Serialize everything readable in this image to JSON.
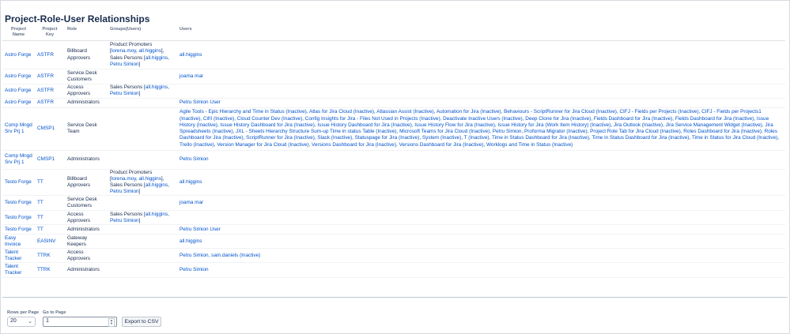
{
  "page": {
    "title": "Project-Role-User Relationships"
  },
  "table": {
    "headers": {
      "project_name": "Project\nName",
      "project_key": "Project\nKey",
      "role": "Role",
      "groups": "Groups(Users)",
      "users": "Users"
    },
    "rows": [
      {
        "name": "Astro Forge",
        "key": "ASTFR",
        "role": "Billboard Approvers",
        "groups": [
          {
            "text": "Product Promoters "
          },
          {
            "text": "[",
            "plain": true
          },
          {
            "text": "lorena.moy",
            "link": true
          },
          {
            "text": ", ",
            "plain": true
          },
          {
            "text": "all.higgins",
            "link": true
          },
          {
            "text": "],",
            "plain": true
          },
          {
            "text": " Sales Persons ",
            "plain": true
          },
          {
            "text": "[",
            "plain": true
          },
          {
            "text": "all.higgins",
            "link": true
          },
          {
            "text": ", ",
            "plain": true
          },
          {
            "text": "Petru Simion",
            "link": true
          },
          {
            "text": "]",
            "plain": true
          }
        ],
        "users": "all.higgins"
      },
      {
        "name": "Astro Forge",
        "key": "ASTFR",
        "role": "Service Desk Customers",
        "groups": [],
        "users": "joama mar"
      },
      {
        "name": "Astro Forge",
        "key": "ASTFR",
        "role": "Access Approvers",
        "groups": [
          {
            "text": "Sales Persons "
          },
          {
            "text": "[",
            "plain": true
          },
          {
            "text": "all.higgins",
            "link": true
          },
          {
            "text": ", ",
            "plain": true
          },
          {
            "text": "Petru Simion",
            "link": true
          },
          {
            "text": "]",
            "plain": true
          }
        ],
        "users": ""
      },
      {
        "name": "Astro Forge",
        "key": "ASTFR",
        "role": "Administrators",
        "groups": [],
        "users": "Petru Simion User"
      },
      {
        "name": "Comp Mngd Srv Prj 1",
        "key": "CMSP1",
        "role": "Service Desk Team",
        "groups": [],
        "users": "Agile Tools - Epic Hierarchy and Time in Status (Inactive), Atlas for Jira Cloud (Inactive), Atlassian Assist (Inactive), Automation for Jira (Inactive), Behaviours - ScriptRunner for Jira Cloud (Inactive), CIFJ - Fields per Projects (Inactive), CIFJ - Fields per Projects1 (Inactive), Cif/I (Inactive), Cloud Counter Dev (Inactive), Config Insights for Jira - Files Not Used in Projects (Inactive), Deactivate Inactive Users (Inactive), Deep Clone for Jira (Inactive), Fields Dashboard for Jira (Inactive), Fields Dashboard for Jira (Inactive), Issue History (Inactive), Issue History Dashboard for Jira (Inactive), Issue History Dashboard for Jira (Inactive), Issue History Flow for Jira (Inactive), Issue History for Jira (Work Item History) (Inactive), Jira Outlook (Inactive), Jira Service Management Widget (Inactive), Jira Spreadsheets (Inactive), JXL - Sheets Hierarchy Structure Sum-up Time in status Table (Inactive), Microsoft Teams for Jira Cloud (Inactive), Petru Simion, Proforma Migrator (Inactive), Project Role Tab for Jira Cloud (Inactive), Roles Dashboard for Jira (Inactive), Roles Dashboard for Jira (Inactive), ScriptRunner for Jira (Inactive), Slack (Inactive), Statuspage for Jira (Inactive), System (Inactive), T (Inactive), Time in Status Dashboard for Jira (Inactive), Time in Status Dashboard for Jira (Inactive), Time in Status for Jira Cloud (Inactive), Trello (Inactive), Version Manager for Jira Cloud (Inactive), Versions Dashboard for Jira (Inactive), Versions Dashboard for Jira (Inactive), Worklogs and Time in Status (Inactive)"
      },
      {
        "name": "Comp Mngd Srv Prj 1",
        "key": "CMSP1",
        "role": "Administrators",
        "groups": [],
        "users": "Petru Simion"
      },
      {
        "name": "Testo Forge",
        "key": "TT",
        "role": "Billboard Approvers",
        "groups": [
          {
            "text": "Product Promoters "
          },
          {
            "text": "[",
            "plain": true
          },
          {
            "text": "lorena.moy",
            "link": true
          },
          {
            "text": ", ",
            "plain": true
          },
          {
            "text": "all.higgins",
            "link": true
          },
          {
            "text": "],",
            "plain": true
          },
          {
            "text": " Sales Persons ",
            "plain": true
          },
          {
            "text": "[",
            "plain": true
          },
          {
            "text": "all.higgins",
            "link": true
          },
          {
            "text": ", ",
            "plain": true
          },
          {
            "text": "Petru Simion",
            "link": true
          },
          {
            "text": "]",
            "plain": true
          }
        ],
        "users": "all.higgins"
      },
      {
        "name": "Testo Forge",
        "key": "TT",
        "role": "Service Desk Customers",
        "groups": [],
        "users": "joama mar"
      },
      {
        "name": "Testo Forge",
        "key": "TT",
        "role": "Access Approvers",
        "groups": [
          {
            "text": "Sales Persons "
          },
          {
            "text": "[",
            "plain": true
          },
          {
            "text": "all.higgins",
            "link": true
          },
          {
            "text": ", ",
            "plain": true
          },
          {
            "text": "Petru Simion",
            "link": true
          },
          {
            "text": "]",
            "plain": true
          }
        ],
        "users": ""
      },
      {
        "name": "Testo Forge",
        "key": "TT",
        "role": "Administrators",
        "groups": [],
        "users": "Petru Simion User"
      },
      {
        "name": "Easy Invoice",
        "key": "EASINV",
        "role": "Gateway Keepers",
        "groups": [],
        "users": "all.higgins"
      },
      {
        "name": "Talent Tracker",
        "key": "TTRK",
        "role": "Access Approvers",
        "groups": [],
        "users": "Petru Simion, sam.daniels (Inactive)"
      },
      {
        "name": "Talent Tracker",
        "key": "TTRK",
        "role": "Administrators",
        "groups": [],
        "users": "Petru Simion"
      }
    ]
  },
  "footer": {
    "rows_per_page_label": "Rows per Page",
    "rows_per_page_value": "20",
    "go_to_page_label": "Go to Page",
    "go_to_page_value": "1",
    "export_label": "Export to CSV"
  },
  "colors": {
    "link": "#0052cc",
    "text": "#172b4d",
    "header": "#5e6c84"
  }
}
